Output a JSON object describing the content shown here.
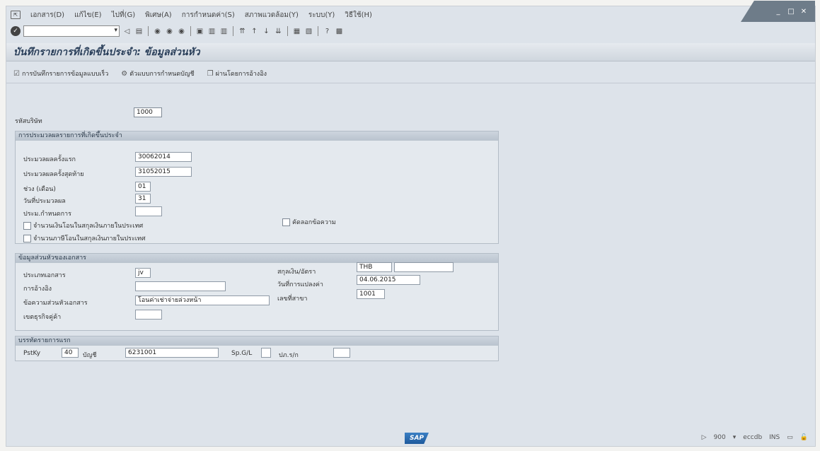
{
  "window": {
    "controls": [
      "_",
      "□",
      "✕"
    ]
  },
  "menu": {
    "items": [
      "เอกสาร(D)",
      "แก้ไข(E)",
      "ไปที่(G)",
      "พิเศษ(A)",
      "การกำหนดค่า(S)",
      "สภาพแวดล้อม(Y)",
      "ระบบ(Y)",
      "วิธีใช้(H)"
    ]
  },
  "toolbar": {
    "command_value": ""
  },
  "title": "บันทึกรายการที่เกิดขึ้นประจำ: ข้อมูลส่วนหัว",
  "app_toolbar": {
    "fast_entry": "การบันทึกรายการข้อมูลแบบเร็ว",
    "acct_model": "ตัวแบบการกำหนดบัญชี",
    "post_ref": "ผ่านโดยการอ้างอิง"
  },
  "company": {
    "label": "รหัสบริษัท",
    "value": "1000"
  },
  "recurring": {
    "header": "การประมวลผลรายการที่เกิดขึ้นประจำ",
    "first_run_label": "ประมวลผลครั้งแรก",
    "first_run_value": "30062014",
    "last_run_label": "ประมวลผลครั้งสุดท้าย",
    "last_run_value": "31052015",
    "interval_label": "ช่วง (เดือน)",
    "interval_value": "01",
    "run_day_label": "วันที่ประมวลผล",
    "run_day_value": "31",
    "schedule_label": "ประม.กำหนดการ",
    "schedule_value": "",
    "cb_transfer_amount": "จำนวนเงินโอนในสกุลเงินภายในประเทศ",
    "cb_transfer_tax": "จำนวนภาษีโอนในสกุลเงินภายในประเทศ",
    "cb_copy_text": "คัดลอกข้อความ"
  },
  "doc_header": {
    "header": "ข้อมูลส่วนหัวของเอกสาร",
    "doc_type_label": "ประเภทเอกสาร",
    "doc_type_value": "jv",
    "reference_label": "การอ้างอิง",
    "reference_value": "",
    "header_text_label": "ข้อความส่วนหัวเอกสาร",
    "header_text_value": "โอนค่าเช่าจ่ายล่วงหน้า",
    "partner_label": "เขตธุรกิจคู่ค้า",
    "partner_value": "",
    "currency_label": "สกุลเงิน/อัตรา",
    "currency_value": "THB",
    "rate_value": "",
    "translation_date_label": "วันที่การแปลงค่า",
    "translation_date_value": "04.06.2015",
    "branch_label": "เลขที่สาขา",
    "branch_value": "1001"
  },
  "first_item": {
    "header": "บรรทัดรายการแรก",
    "pstky_label": "PstKy",
    "pstky_value": "40",
    "account_label": "บัญชี",
    "account_value": "6231001",
    "spgl_label": "Sp.G/L",
    "spgl_value": "",
    "ttype_label": "ปภ.ร/ก",
    "ttype_value": ""
  },
  "status": {
    "logo": "SAP",
    "client": "900",
    "server": "eccdb",
    "mode": "INS"
  }
}
